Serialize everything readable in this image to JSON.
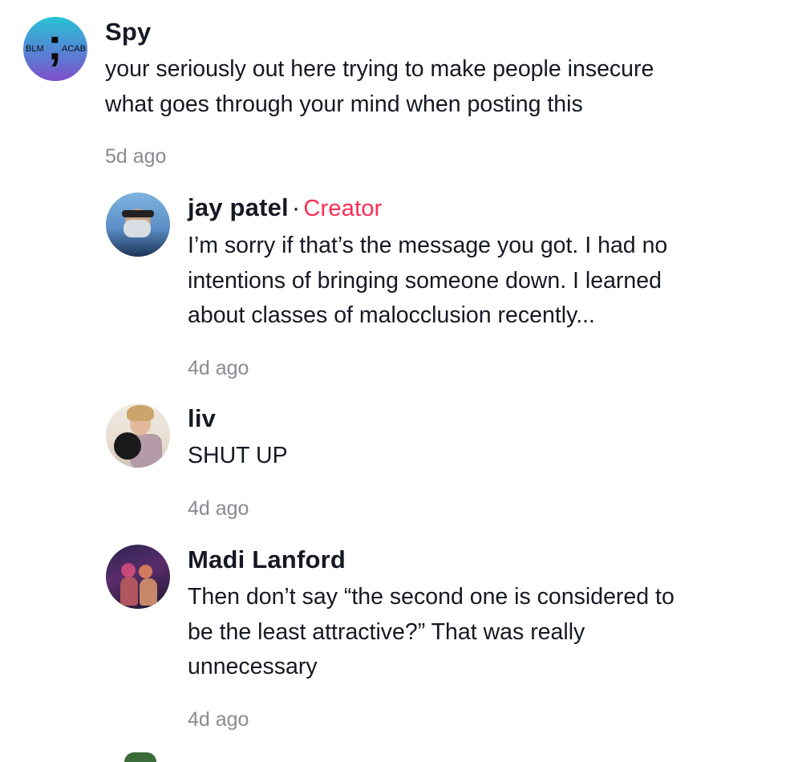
{
  "comments": [
    {
      "author": "Spy",
      "avatar_icon": "spy-avatar-semicolon",
      "avatar_text_left": "BLM",
      "avatar_text_right": "ACAB",
      "text_lines": [
        "your seriously out here trying to make people insecure",
        "what goes through your mind when posting this"
      ],
      "time": "5d ago"
    },
    {
      "author": "jay patel",
      "separator": "·",
      "badge": "Creator",
      "avatar_icon": "jay-patel-avatar",
      "text_lines": [
        "I’m sorry if that’s the message you got. I had no",
        "intentions of bringing someone down. I learned",
        "about classes of malocclusion recently..."
      ],
      "time": "4d ago"
    },
    {
      "author": "liv",
      "avatar_icon": "liv-avatar",
      "text_lines": [
        "SHUT UP"
      ],
      "time": "4d ago"
    },
    {
      "author": "Madi Lanford",
      "avatar_icon": "madi-lanford-avatar",
      "text_lines": [
        "Then don’t say “the second one is considered to",
        "be the least attractive?” That was really",
        "unnecessary"
      ],
      "time": "4d ago"
    }
  ],
  "colors": {
    "text": "#161823",
    "creator_badge": "#fe2c55",
    "timestamp": "#8a8b91",
    "background": "#ffffff"
  }
}
